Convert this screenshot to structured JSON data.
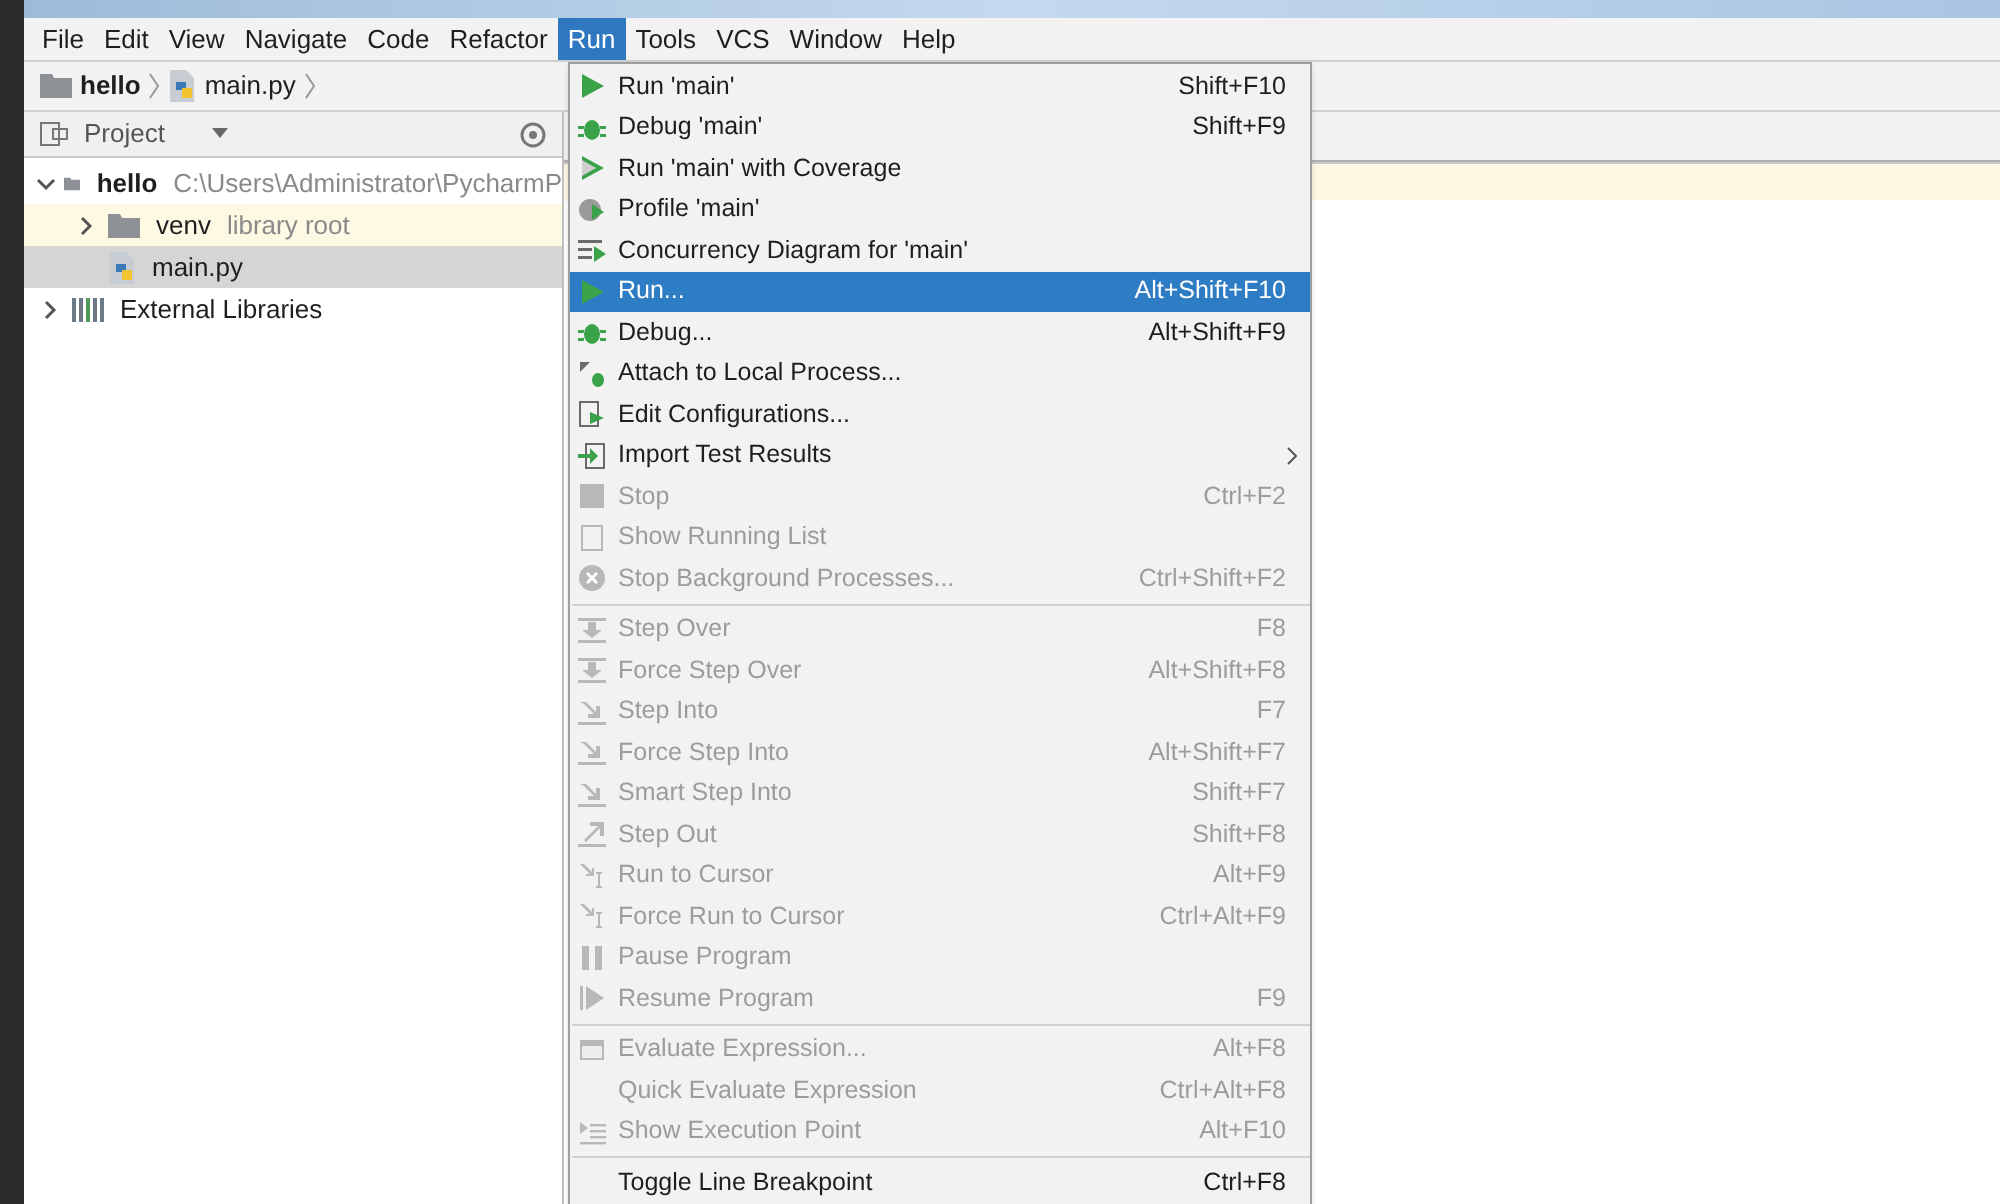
{
  "menu_bar": [
    {
      "label": "File",
      "selected": false
    },
    {
      "label": "Edit",
      "selected": false
    },
    {
      "label": "View",
      "selected": false
    },
    {
      "label": "Navigate",
      "selected": false
    },
    {
      "label": "Code",
      "selected": false
    },
    {
      "label": "Refactor",
      "selected": false
    },
    {
      "label": "Run",
      "selected": true
    },
    {
      "label": "Tools",
      "selected": false
    },
    {
      "label": "VCS",
      "selected": false
    },
    {
      "label": "Window",
      "selected": false
    },
    {
      "label": "Help",
      "selected": false
    }
  ],
  "breadcrumb": [
    {
      "label": "hello",
      "kind": "folder"
    },
    {
      "label": "main.py",
      "kind": "file"
    }
  ],
  "project_panel": {
    "title": "Project",
    "tree": [
      {
        "name": "hello",
        "hint": "C:\\Users\\Administrator\\PycharmP",
        "kind": "folder",
        "expanded": true,
        "selected": false,
        "children": [
          {
            "name": "venv",
            "hint": "library root",
            "kind": "library-folder",
            "expanded": false,
            "selected": false
          },
          {
            "name": "main.py",
            "kind": "file",
            "selected": true
          }
        ]
      },
      {
        "name": "External Libraries",
        "kind": "libraries",
        "expanded": false,
        "selected": false
      }
    ]
  },
  "run_menu": [
    {
      "kind": "item",
      "label": "Run 'main'",
      "shortcut": "Shift+F10",
      "disabled": false,
      "selected": false
    },
    {
      "kind": "item",
      "label": "Debug 'main'",
      "shortcut": "Shift+F9",
      "disabled": false,
      "selected": false
    },
    {
      "kind": "item",
      "label": "Run 'main' with Coverage",
      "disabled": false,
      "selected": false
    },
    {
      "kind": "item",
      "label": "Profile 'main'",
      "disabled": false,
      "selected": false
    },
    {
      "kind": "item",
      "label": "Concurrency Diagram for 'main'",
      "disabled": false,
      "selected": false
    },
    {
      "kind": "item",
      "label": "Run...",
      "shortcut": "Alt+Shift+F10",
      "disabled": false,
      "selected": true
    },
    {
      "kind": "item",
      "label": "Debug...",
      "shortcut": "Alt+Shift+F9",
      "disabled": false,
      "selected": false
    },
    {
      "kind": "item",
      "label": "Attach to Local Process...",
      "disabled": false,
      "selected": false
    },
    {
      "kind": "item",
      "label": "Edit Configurations...",
      "disabled": false,
      "selected": false
    },
    {
      "kind": "submenu",
      "label": "Import Test Results",
      "disabled": false,
      "selected": false
    },
    {
      "kind": "item",
      "label": "Stop",
      "shortcut": "Ctrl+F2",
      "disabled": true,
      "selected": false
    },
    {
      "kind": "item",
      "label": "Show Running List",
      "disabled": true,
      "selected": false
    },
    {
      "kind": "item",
      "label": "Stop Background Processes...",
      "shortcut": "Ctrl+Shift+F2",
      "disabled": true,
      "selected": false
    },
    {
      "kind": "separator"
    },
    {
      "kind": "item",
      "label": "Step Over",
      "shortcut": "F8",
      "disabled": true,
      "selected": false
    },
    {
      "kind": "item",
      "label": "Force Step Over",
      "shortcut": "Alt+Shift+F8",
      "disabled": true,
      "selected": false
    },
    {
      "kind": "item",
      "label": "Step Into",
      "shortcut": "F7",
      "disabled": true,
      "selected": false
    },
    {
      "kind": "item",
      "label": "Force Step Into",
      "shortcut": "Alt+Shift+F7",
      "disabled": true,
      "selected": false
    },
    {
      "kind": "item",
      "label": "Smart Step Into",
      "shortcut": "Shift+F7",
      "disabled": true,
      "selected": false
    },
    {
      "kind": "item",
      "label": "Step Out",
      "shortcut": "Shift+F8",
      "disabled": true,
      "selected": false
    },
    {
      "kind": "item",
      "label": "Run to Cursor",
      "shortcut": "Alt+F9",
      "disabled": true,
      "selected": false
    },
    {
      "kind": "item",
      "label": "Force Run to Cursor",
      "shortcut": "Ctrl+Alt+F9",
      "disabled": true,
      "selected": false
    },
    {
      "kind": "item",
      "label": "Pause Program",
      "disabled": true,
      "selected": false
    },
    {
      "kind": "item",
      "label": "Resume Program",
      "shortcut": "F9",
      "disabled": true,
      "selected": false
    },
    {
      "kind": "separator"
    },
    {
      "kind": "item",
      "label": "Evaluate Expression...",
      "shortcut": "Alt+F8",
      "disabled": true,
      "selected": false
    },
    {
      "kind": "item",
      "label": "Quick Evaluate Expression",
      "shortcut": "Ctrl+Alt+F8",
      "disabled": true,
      "selected": false
    },
    {
      "kind": "item",
      "label": "Show Execution Point",
      "shortcut": "Alt+F10",
      "disabled": true,
      "selected": false
    },
    {
      "kind": "separator"
    },
    {
      "kind": "item",
      "label": "Toggle Line Breakpoint",
      "shortcut": "Ctrl+F8",
      "disabled": false,
      "selected": false
    }
  ]
}
